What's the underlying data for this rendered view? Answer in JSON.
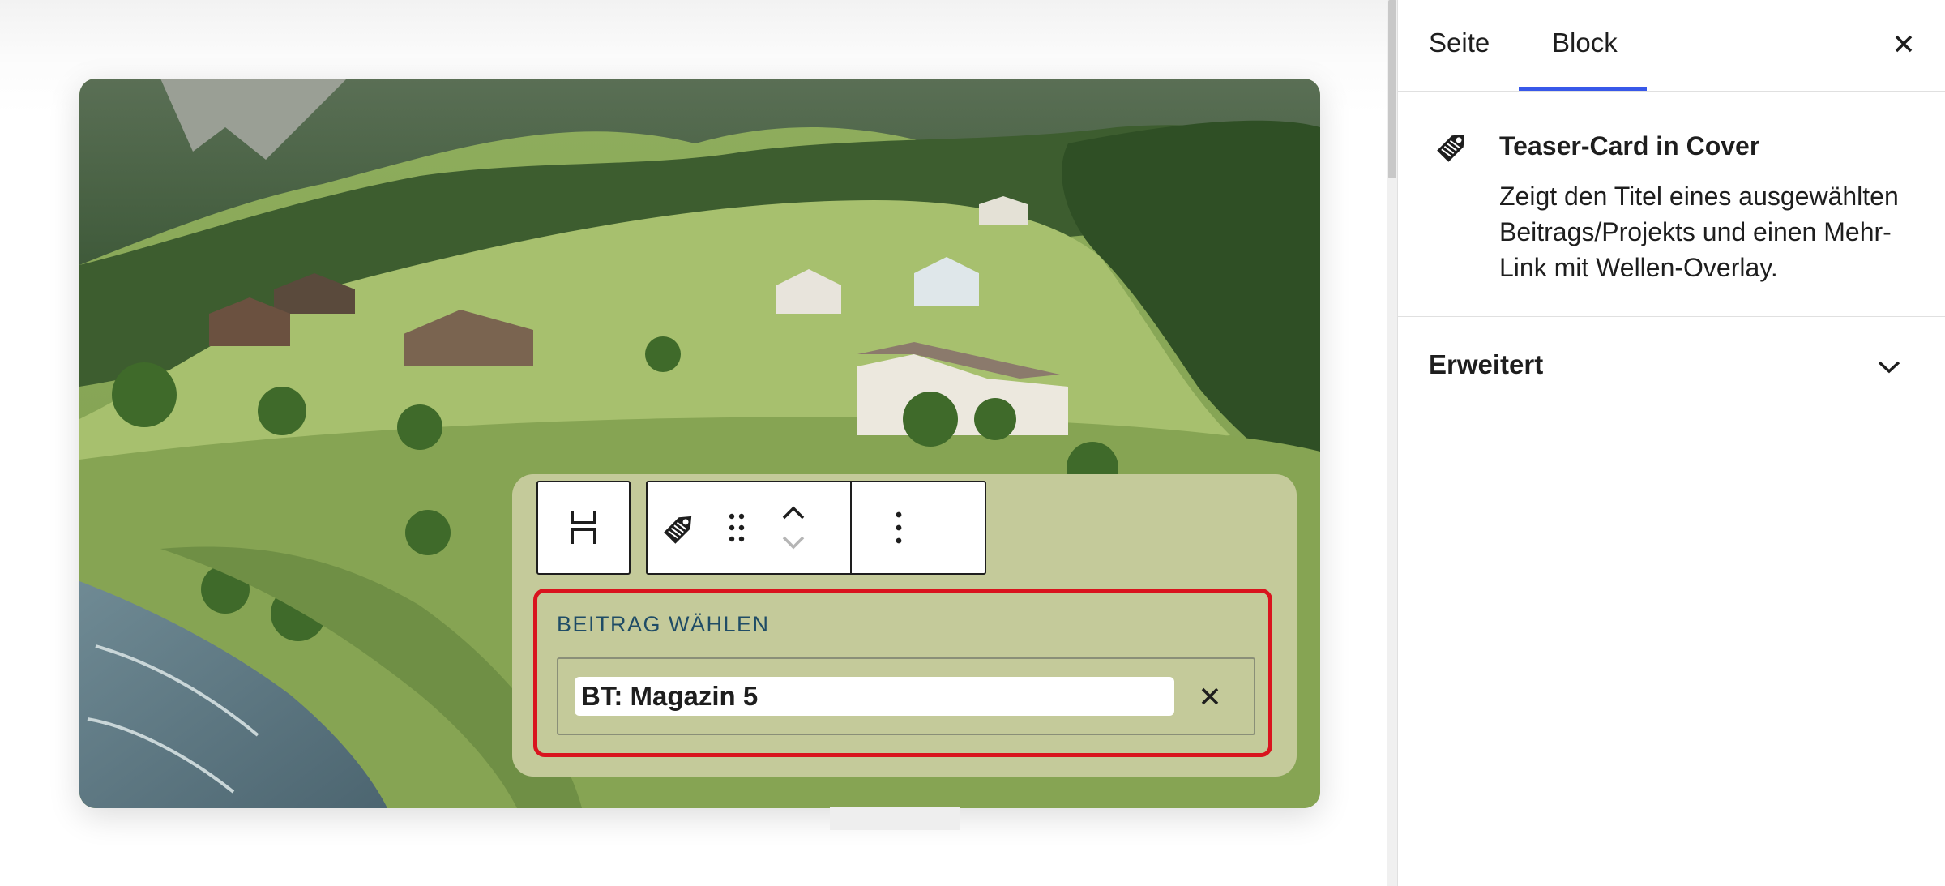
{
  "editor": {
    "card": {
      "picker_label": "BEITRAG WÄHLEN",
      "selected_post": "BT: Magazin 5"
    },
    "toolbar_icons": [
      "select-parent-icon",
      "tag-icon",
      "drag-handle-icon",
      "move-up-icon",
      "move-down-icon",
      "more-options-icon"
    ]
  },
  "sidebar": {
    "tabs": [
      {
        "label": "Seite",
        "active": false
      },
      {
        "label": "Block",
        "active": true
      }
    ],
    "block": {
      "title": "Teaser-Card in Cover",
      "description": "Zeigt den Titel eines ausgewählten Beitrags/Projekts und einen Mehr-Link mit Wellen-Overlay."
    },
    "panels": [
      {
        "label": "Erweitert",
        "expanded": false
      }
    ]
  },
  "colors": {
    "accent": "#3858e9",
    "card_background": "#c4ca9a",
    "picker_highlight": "#d9141e",
    "label_color": "#1f4c66"
  }
}
